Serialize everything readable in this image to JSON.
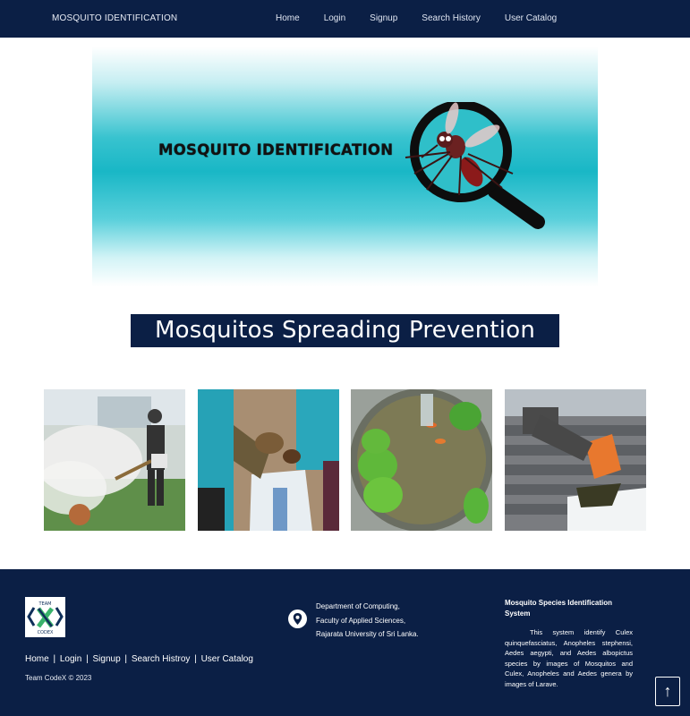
{
  "navbar": {
    "brand": "MOSQUITO IDENTIFICATION",
    "links": [
      "Home",
      "Login",
      "Signup",
      "Search History",
      "User Catalog"
    ]
  },
  "hero": {
    "title": "MOSQUITO IDENTIFICATION"
  },
  "prevention": {
    "title": "Mosquitos Spreading Prevention"
  },
  "photos": [
    {
      "alt": "Fogging"
    },
    {
      "alt": "Cleaning"
    },
    {
      "alt": "Water"
    },
    {
      "alt": "Gutter"
    }
  ],
  "footer": {
    "logo_text_top": "TEAM",
    "logo_text_bottom": "CODEX",
    "links": [
      "Home",
      "Login",
      "Signup",
      "Search Histroy",
      "User Catalog"
    ],
    "separator": "|",
    "copyright": "Team CodeX © 2023",
    "address_lines": [
      "Department of Computing,",
      "Faculty of Applied Sciences,",
      "Rajarata University of Sri Lanka."
    ],
    "about_title": "Mosquito Species Identification System",
    "about_text": "This system identify Culex quinquefasciatus, Anopheles stephensi, Aedes aegypti, and Aedes albopictus species by images of Mosquitos and Culex, Anopheles and Aedes genera by images of Larave.",
    "top_button": "↑"
  },
  "colors": {
    "navy": "#0b1f45",
    "teal": "#19b7c6"
  },
  "icons": {
    "location": "map-pin-icon",
    "scroll_top": "arrow-up-icon"
  }
}
